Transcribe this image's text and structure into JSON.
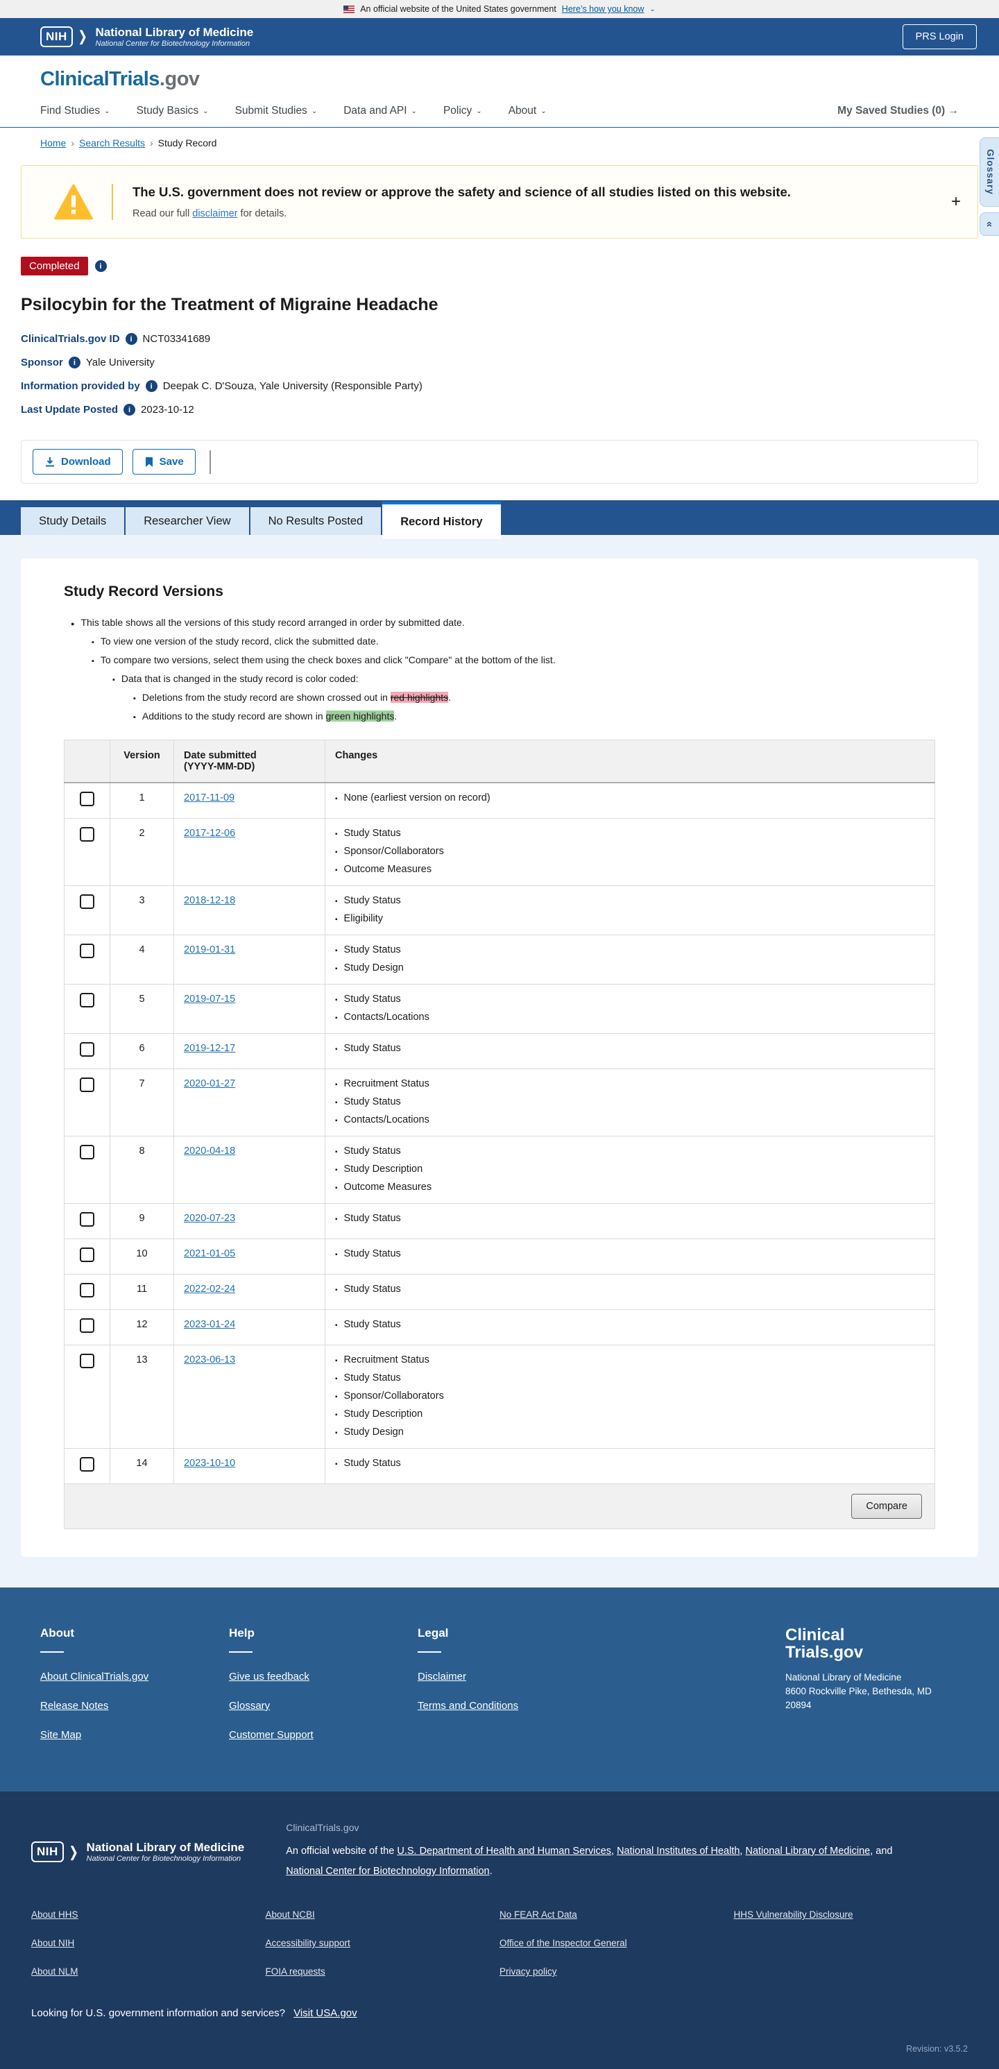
{
  "banner": {
    "text": "An official website of the United States government",
    "link": "Here’s how you know",
    "chevron": "⌄"
  },
  "nih_header": {
    "logo": "NIH",
    "org": "National Library of Medicine",
    "sub": "National Center for Biotechnology Information",
    "prs_login": "PRS Login"
  },
  "site": {
    "logo_main": "ClinicalTrials",
    "logo_suffix": ".gov",
    "nav": [
      {
        "label": "Find Studies"
      },
      {
        "label": "Study Basics"
      },
      {
        "label": "Submit Studies"
      },
      {
        "label": "Data and API"
      },
      {
        "label": "Policy"
      },
      {
        "label": "About"
      }
    ],
    "saved_label": "My Saved Studies (0)",
    "saved_arrow": "→"
  },
  "breadcrumb": {
    "items": [
      {
        "label": "Home",
        "link": true
      },
      {
        "label": "Search Results",
        "link": true
      },
      {
        "label": "Study Record",
        "link": false
      }
    ],
    "separator": "›"
  },
  "glossary": {
    "label": "Glossary",
    "collapse": "«"
  },
  "warning": {
    "title": "The U.S. government does not review or approve the safety and science of all studies listed on this website.",
    "body_prefix": "Read our full ",
    "link": "disclaimer",
    "body_suffix": " for details.",
    "expand": "+"
  },
  "study": {
    "status": "Completed",
    "title": "Psilocybin for the Treatment of Migraine Headache",
    "fields": [
      {
        "label": "ClinicalTrials.gov ID",
        "value": "NCT03341689"
      },
      {
        "label": "Sponsor",
        "value": "Yale University"
      },
      {
        "label": "Information provided by",
        "value": "Deepak C. D'Souza, Yale University (Responsible Party)"
      },
      {
        "label": "Last Update Posted",
        "value": "2023-10-12"
      }
    ]
  },
  "toolbar": {
    "download": "Download",
    "save": "Save"
  },
  "tabs": [
    {
      "label": "Study Details",
      "active": false
    },
    {
      "label": "Researcher View",
      "active": false
    },
    {
      "label": "No Results Posted",
      "active": false
    },
    {
      "label": "Record History",
      "active": true
    }
  ],
  "record_history": {
    "heading": "Study Record Versions",
    "notes": [
      {
        "level": 1,
        "parts": [
          {
            "t": "This table shows all the versions of this study record arranged in order by submitted date."
          }
        ]
      },
      {
        "level": 2,
        "parts": [
          {
            "t": "To view one version of the study record, click the submitted date."
          }
        ]
      },
      {
        "level": 2,
        "parts": [
          {
            "t": "To compare two versions, select them using the check boxes and click \"Compare\" at the bottom of the list."
          }
        ]
      },
      {
        "level": 3,
        "parts": [
          {
            "t": "Data that is changed in the study record is color coded:"
          }
        ]
      },
      {
        "level": 4,
        "parts": [
          {
            "t": "Deletions from the study record are shown crossed out in "
          },
          {
            "t": "red highlights",
            "mark": "red"
          },
          {
            "t": "."
          }
        ]
      },
      {
        "level": 4,
        "parts": [
          {
            "t": "Additions to the study record are shown in "
          },
          {
            "t": "green highlights",
            "mark": "green"
          },
          {
            "t": "."
          }
        ]
      }
    ],
    "table": {
      "header_version": "Version",
      "header_date_line1": "Date submitted",
      "header_date_line2": "(YYYY-MM-DD)",
      "header_changes": "Changes",
      "rows": [
        {
          "version": "1",
          "date": "2017-11-09",
          "changes": [
            "None (earliest version on record)"
          ]
        },
        {
          "version": "2",
          "date": "2017-12-06",
          "changes": [
            "Study Status",
            "Sponsor/Collaborators",
            "Outcome Measures"
          ]
        },
        {
          "version": "3",
          "date": "2018-12-18",
          "changes": [
            "Study Status",
            "Eligibility"
          ]
        },
        {
          "version": "4",
          "date": "2019-01-31",
          "changes": [
            "Study Status",
            "Study Design"
          ]
        },
        {
          "version": "5",
          "date": "2019-07-15",
          "changes": [
            "Study Status",
            "Contacts/Locations"
          ]
        },
        {
          "version": "6",
          "date": "2019-12-17",
          "changes": [
            "Study Status"
          ]
        },
        {
          "version": "7",
          "date": "2020-01-27",
          "changes": [
            "Recruitment Status",
            "Study Status",
            "Contacts/Locations"
          ]
        },
        {
          "version": "8",
          "date": "2020-04-18",
          "changes": [
            "Study Status",
            "Study Description",
            "Outcome Measures"
          ]
        },
        {
          "version": "9",
          "date": "2020-07-23",
          "changes": [
            "Study Status"
          ]
        },
        {
          "version": "10",
          "date": "2021-01-05",
          "changes": [
            "Study Status"
          ]
        },
        {
          "version": "11",
          "date": "2022-02-24",
          "changes": [
            "Study Status"
          ]
        },
        {
          "version": "12",
          "date": "2023-01-24",
          "changes": [
            "Study Status"
          ]
        },
        {
          "version": "13",
          "date": "2023-06-13",
          "changes": [
            "Recruitment Status",
            "Study Status",
            "Sponsor/Collaborators",
            "Study Description",
            "Study Design"
          ]
        },
        {
          "version": "14",
          "date": "2023-10-10",
          "changes": [
            "Study Status"
          ]
        }
      ],
      "compare_label": "Compare"
    }
  },
  "footer": {
    "columns": [
      {
        "heading": "About",
        "links": [
          "About ClinicalTrials.gov",
          "Release Notes",
          "Site Map"
        ]
      },
      {
        "heading": "Help",
        "links": [
          "Give us feedback",
          "Glossary",
          "Customer Support"
        ]
      },
      {
        "heading": "Legal",
        "links": [
          "Disclaimer",
          "Terms and Conditions"
        ]
      }
    ],
    "brand_line1": "Clinical",
    "brand_line2": "Trials.gov",
    "address": [
      "National Library of Medicine",
      "8600 Rockville Pike, Bethesda, MD",
      "20894"
    ]
  },
  "nlm_footer": {
    "logo": "NIH",
    "org": "National Library of Medicine",
    "sub": "National Center for Biotechnology Information",
    "site_name": "ClinicalTrials.gov",
    "sentence_parts": [
      {
        "t": "An official website of the "
      },
      {
        "t": "U.S. Department of Health and Human Services",
        "link": true
      },
      {
        "t": ", "
      },
      {
        "t": "National Institutes of Health",
        "link": true
      },
      {
        "t": ", "
      },
      {
        "t": "National Library of Medicine",
        "link": true
      },
      {
        "t": ", and "
      },
      {
        "t": "National Center for Biotechnology Information",
        "link": true
      },
      {
        "t": "."
      }
    ],
    "link_columns": [
      [
        "About HHS",
        "About NIH",
        "About NLM"
      ],
      [
        "About NCBI",
        "Accessibility support",
        "FOIA requests"
      ],
      [
        "No FEAR Act Data",
        "Office of the Inspector General",
        "Privacy policy"
      ],
      [
        "HHS Vulnerability Disclosure"
      ]
    ],
    "usa_text": "Looking for U.S. government information and services?",
    "usa_link": "Visit USA.gov",
    "revision": "Revision: v3.5.2"
  }
}
